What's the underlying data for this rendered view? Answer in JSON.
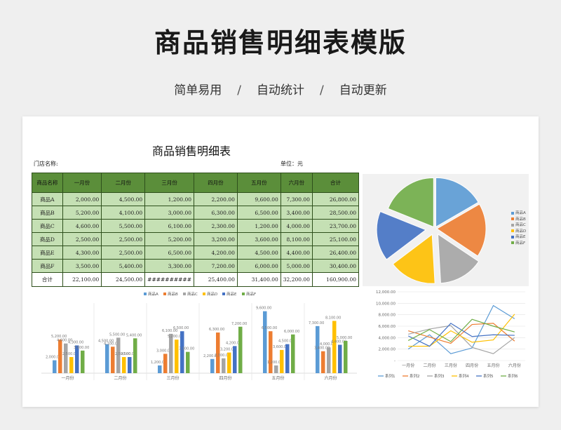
{
  "header": {
    "title": "商品销售明细表模版",
    "tags": [
      "简单易用",
      "自动统计",
      "自动更新"
    ],
    "sep": "/"
  },
  "sheet": {
    "title": "商品销售明细表",
    "store_label": "门店名称:",
    "unit_label": "单位：元",
    "columns": [
      "商品名称",
      "一月份",
      "二月份",
      "三月份",
      "四月份",
      "五月份",
      "六月份",
      "合计"
    ],
    "rows": [
      [
        "商品A",
        "2,000.00",
        "4,500.00",
        "1,200.00",
        "2,200.00",
        "9,600.00",
        "7,300.00",
        "26,800.00"
      ],
      [
        "商品B",
        "5,200.00",
        "4,100.00",
        "3,000.00",
        "6,300.00",
        "6,500.00",
        "3,400.00",
        "28,500.00"
      ],
      [
        "商品C",
        "4,600.00",
        "5,500.00",
        "6,100.00",
        "2,300.00",
        "1,200.00",
        "4,000.00",
        "23,700.00"
      ],
      [
        "商品D",
        "2,500.00",
        "2,500.00",
        "5,200.00",
        "3,200.00",
        "3,600.00",
        "8,100.00",
        "25,100.00"
      ],
      [
        "商品E",
        "4,300.00",
        "2,500.00",
        "6,500.00",
        "4,200.00",
        "4,500.00",
        "4,400.00",
        "26,400.00"
      ],
      [
        "商品F",
        "3,500.00",
        "5,400.00",
        "3,300.00",
        "7,200.00",
        "6,000.00",
        "5,000.00",
        "30,400.00"
      ]
    ],
    "total": [
      "合计",
      "22,100.00",
      "24,500.00",
      "##########",
      "25,400.00",
      "31,400.00",
      "32,200.00",
      "160,900.00"
    ]
  },
  "colors": {
    "header_green": "#5b8e3a",
    "cell_green": "#c5e0b4",
    "series": [
      "#5b9bd5",
      "#ed7d31",
      "#a5a5a5",
      "#ffc000",
      "#4472c4",
      "#70ad47"
    ]
  },
  "chart_data": [
    {
      "type": "pie",
      "labels": [
        "商品A",
        "商品B",
        "商品C",
        "商品D",
        "商品E",
        "商品F"
      ],
      "values": [
        26800,
        28500,
        23700,
        25100,
        26400,
        30400
      ],
      "legend": "right",
      "exploded": true
    },
    {
      "type": "bar",
      "categories": [
        "一月份",
        "二月份",
        "三月份",
        "四月份",
        "五月份",
        "六月份"
      ],
      "series": [
        {
          "name": "商品A",
          "values": [
            2000,
            4500,
            1200,
            2200,
            9600,
            7300
          ]
        },
        {
          "name": "商品B",
          "values": [
            5200,
            4100,
            3000,
            6300,
            6500,
            3400
          ]
        },
        {
          "name": "商品C",
          "values": [
            4600,
            5500,
            6100,
            2300,
            1200,
            4000
          ]
        },
        {
          "name": "商品D",
          "values": [
            2500,
            2500,
            5200,
            3200,
            3600,
            8100
          ]
        },
        {
          "name": "商品E",
          "values": [
            4300,
            2500,
            6500,
            4200,
            4500,
            4400
          ]
        },
        {
          "name": "商品F",
          "values": [
            3500,
            5400,
            3300,
            7200,
            6000,
            5000
          ]
        }
      ],
      "value_labels": [
        [
          "2,000.00",
          "5,200.00",
          "4,600.00",
          "2,500.00",
          "4,300.00",
          "3,500.00"
        ],
        [
          "4,500.00",
          "4,100.00",
          "5,500.00",
          "2,500.00",
          "2,500.00",
          "5,400.00"
        ],
        [
          "1,200.00",
          "3,000.00",
          "6,100.00",
          "5,200.00",
          "6,500.00",
          "3,300.00"
        ],
        [
          "2,200.00",
          "6,300.00",
          "2,300.00",
          "3,200.00",
          "4,200.00",
          "7,200.00"
        ],
        [
          "9,600.00",
          "6,500.00",
          "1,200.00",
          "3,600.00",
          "4,500.00",
          "6,000.00"
        ],
        [
          "7,300.00",
          "3,400.00",
          "4,000.00",
          "8,100.00",
          "4,400.00",
          "5,000.00"
        ]
      ],
      "ylim": [
        0,
        10000
      ],
      "legend": "top"
    },
    {
      "type": "line",
      "categories": [
        "一月份",
        "二月份",
        "三月份",
        "四月份",
        "五月份",
        "六月份"
      ],
      "series": [
        {
          "name": "系列1",
          "values": [
            2000,
            4500,
            1200,
            2200,
            9600,
            7300
          ]
        },
        {
          "name": "系列2",
          "values": [
            5200,
            4100,
            3000,
            6300,
            6500,
            3400
          ]
        },
        {
          "name": "系列3",
          "values": [
            4600,
            5500,
            6100,
            2300,
            1200,
            4000
          ]
        },
        {
          "name": "系列4",
          "values": [
            2500,
            2500,
            5200,
            3200,
            3600,
            8100
          ]
        },
        {
          "name": "系列5",
          "values": [
            4300,
            2500,
            6500,
            4200,
            4500,
            4400
          ]
        },
        {
          "name": "系列6",
          "values": [
            3500,
            5400,
            3300,
            7200,
            6000,
            5000
          ]
        }
      ],
      "yticks": [
        "-",
        "2,000.00",
        "4,000.00",
        "6,000.00",
        "8,000.00",
        "10,000.00",
        "12,000.00"
      ],
      "ylim": [
        0,
        12000
      ],
      "grid": true,
      "legend": "bottom"
    }
  ]
}
